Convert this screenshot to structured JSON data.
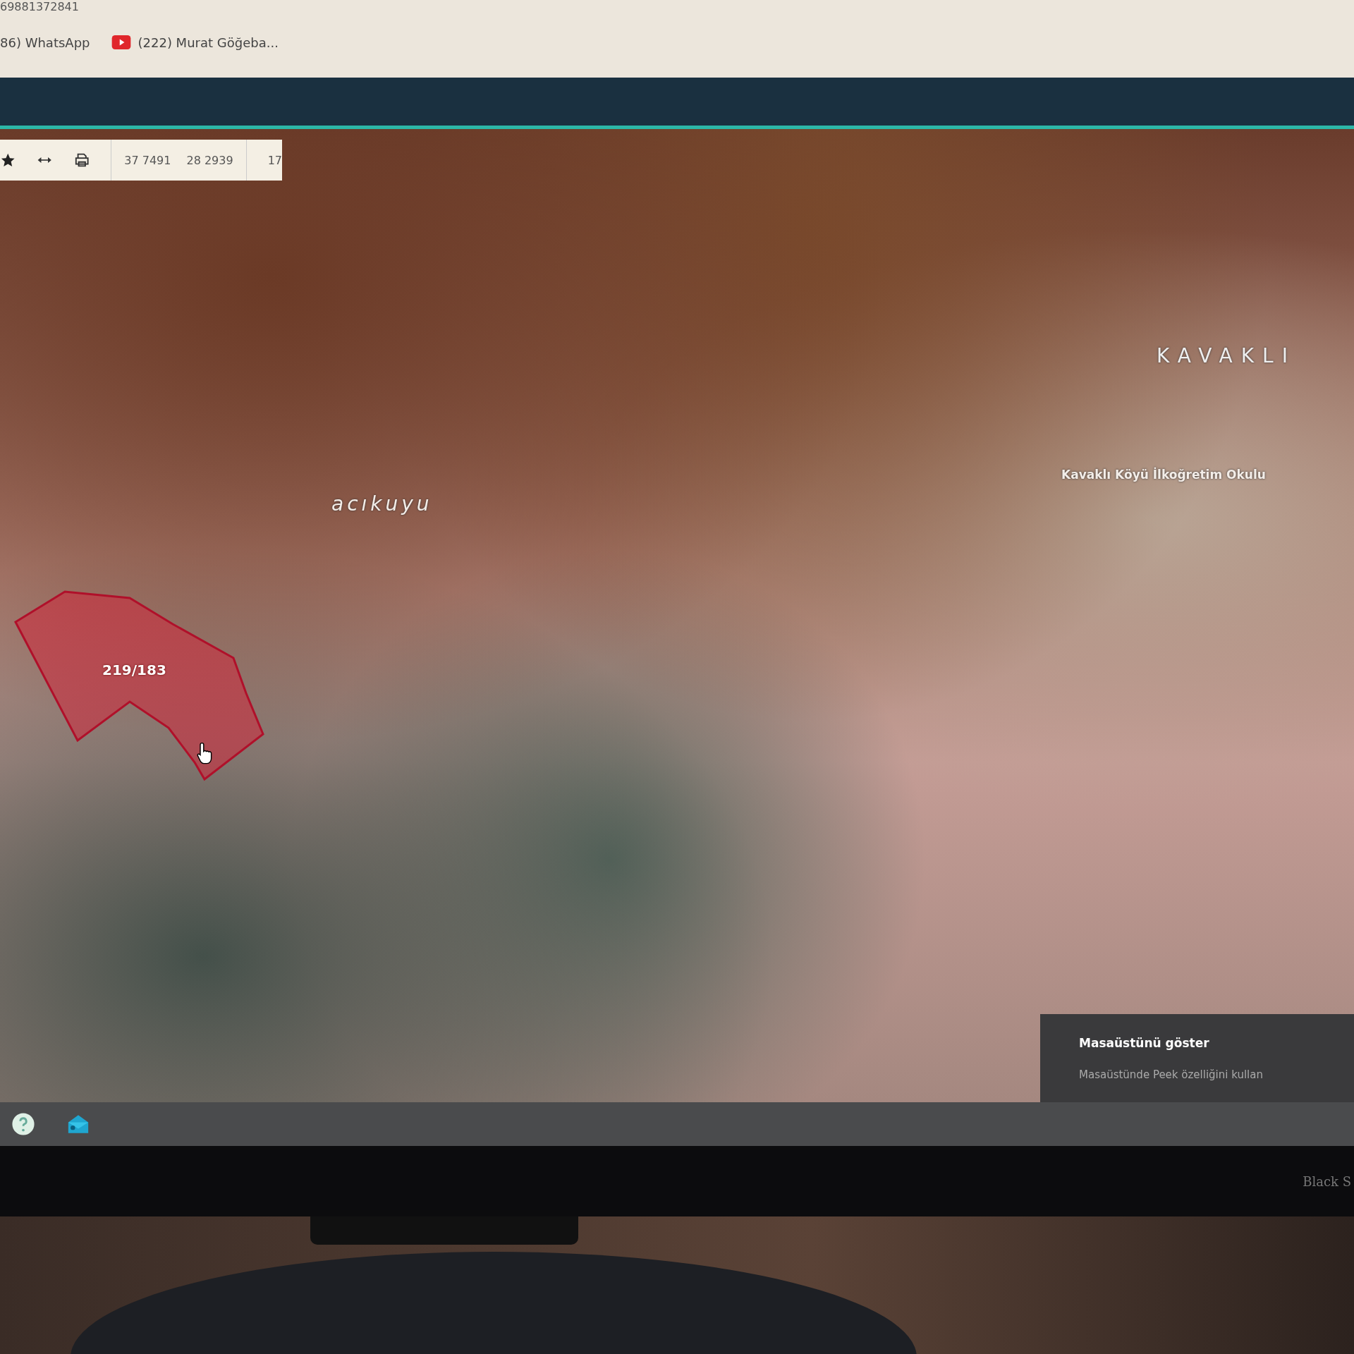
{
  "browser": {
    "address_fragment": "69881372841",
    "bookmarks": [
      {
        "label": "86) WhatsApp",
        "kind": "plain"
      },
      {
        "label": "(222) Murat Göğeba...",
        "kind": "youtube"
      }
    ]
  },
  "map_toolbar": {
    "coordinates": [
      "37 7491",
      "28 2939"
    ],
    "zoom": "17"
  },
  "map": {
    "labels": [
      {
        "text": "acıkuyu",
        "kind": "area"
      },
      {
        "text": "KAVAKLI",
        "kind": "village"
      },
      {
        "text": "Kavaklı Köyü İlkoğretim Okulu",
        "kind": "poi"
      }
    ],
    "parcel": {
      "label": "219/183"
    }
  },
  "tooltip": {
    "title": "Masaüstünü göster",
    "text": "Masaüstünde Peek özelliğini kullan"
  },
  "monitor": {
    "brand": "Black S"
  }
}
